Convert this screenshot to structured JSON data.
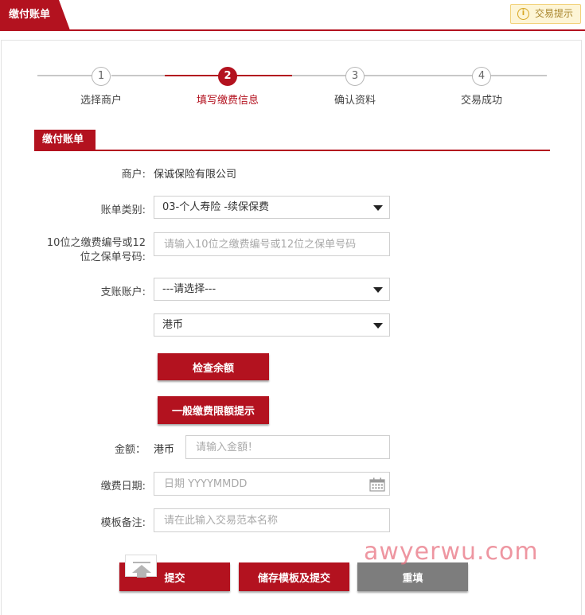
{
  "header": {
    "tab_title": "缴付账单",
    "tip_button": "交易提示",
    "tip_icon": "i"
  },
  "steps": [
    {
      "number": "1",
      "label": "选择商户"
    },
    {
      "number": "2",
      "label": "填写缴费信息"
    },
    {
      "number": "3",
      "label": "确认资料"
    },
    {
      "number": "4",
      "label": "交易成功"
    }
  ],
  "active_step": 2,
  "section": {
    "title": "缴付账单"
  },
  "form": {
    "merchant_label": "商户:",
    "merchant_value": "保诚保险有限公司",
    "bill_type_label": "账单类别:",
    "bill_type_value": "03-个人寿险 -续保保费",
    "ref_label_line1": "10位之缴费编号或12",
    "ref_label_line2": "位之保单号码:",
    "ref_placeholder": "请输入10位之缴费编号或12位之保单号码",
    "account_label": "支账账户:",
    "account_value": "---请选择---",
    "currency_value": "港币",
    "check_balance_button": "检查余额",
    "limit_tip_button": "一般缴费限额提示",
    "amount_label": "金额：",
    "amount_currency": "港币",
    "amount_placeholder": "请输入金額！",
    "date_label": "缴费日期:",
    "date_placeholder": "日期 YYYYMMDD",
    "remark_label": "模板备注:",
    "remark_placeholder": "请在此输入交易范本名称"
  },
  "actions": {
    "submit": "提交",
    "save_template_submit": "储存模板及提交",
    "reset": "重填"
  },
  "watermark": "awyerwu.com",
  "colors": {
    "brand_red": "#b3121f",
    "gray_button": "#7d7d7d",
    "tip_background": "#fdf5d6"
  },
  "icons": {
    "tip": "info-circle-icon",
    "dropdown": "caret-down-icon",
    "calendar": "calendar-icon",
    "back_to_top": "back-to-top-icon"
  }
}
